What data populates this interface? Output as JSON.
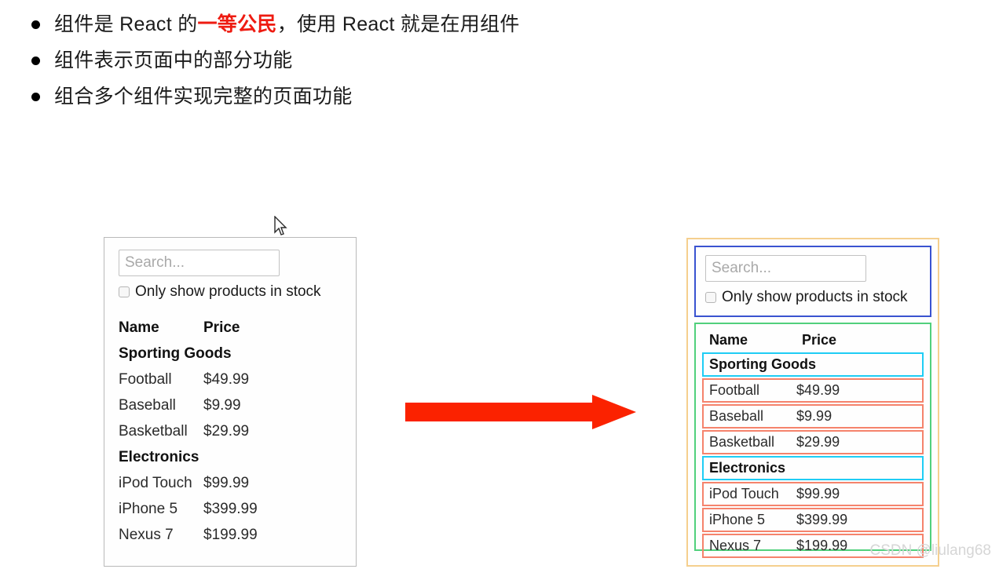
{
  "slide": {
    "bullets": [
      {
        "pre": "组件是 React 的",
        "highlight": "一等公民",
        "post": "，使用 React 就是在用组件"
      },
      {
        "pre": "组件表示页面中的部分功能",
        "highlight": "",
        "post": ""
      },
      {
        "pre": "组合多个组件实现完整的页面功能",
        "highlight": "",
        "post": ""
      }
    ]
  },
  "product_ui": {
    "search": {
      "placeholder": "Search...",
      "value": ""
    },
    "stock_filter": {
      "label": "Only show products in stock",
      "checked": false
    },
    "columns": {
      "name": "Name",
      "price": "Price"
    },
    "rows": [
      {
        "type": "category",
        "name": "Sporting Goods",
        "price": ""
      },
      {
        "type": "product",
        "name": "Football",
        "price": "$49.99",
        "in_stock": true
      },
      {
        "type": "product",
        "name": "Baseball",
        "price": "$9.99",
        "in_stock": true
      },
      {
        "type": "product",
        "name": "Basketball",
        "price": "$29.99",
        "in_stock": false
      },
      {
        "type": "category",
        "name": "Electronics",
        "price": ""
      },
      {
        "type": "product",
        "name": "iPod Touch",
        "price": "$99.99",
        "in_stock": true
      },
      {
        "type": "product",
        "name": "iPhone 5",
        "price": "$399.99",
        "in_stock": false
      },
      {
        "type": "product",
        "name": "Nexus 7",
        "price": "$199.99",
        "in_stock": true
      }
    ]
  },
  "annotation_colors": {
    "outer_app": "#f5cf8e",
    "search_bar": "#3a53d0",
    "product_table": "#51d07c",
    "category_row": "#1fcdf5",
    "product_row": "#f5836c",
    "arrow": "#fb2200",
    "out_of_stock_text": "#fb2b12",
    "highlight_text": "#ee1b11"
  },
  "watermark": {
    "text": "CSDN @liulang68"
  }
}
